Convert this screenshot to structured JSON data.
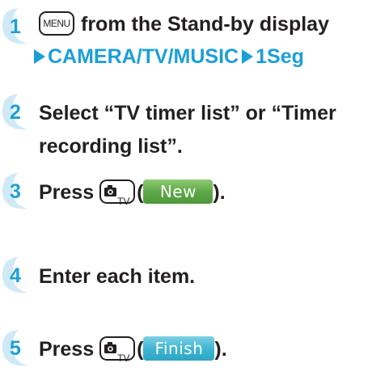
{
  "steps": [
    {
      "number": "1",
      "menu_key": "MENU",
      "line1": "from the Stand-by display",
      "path": [
        "CAMERA/TV/MUSIC",
        "1Seg"
      ]
    },
    {
      "number": "2",
      "line1": "Select “TV timer list” or “Timer",
      "line2": "recording list”."
    },
    {
      "number": "3",
      "prefix": "Press",
      "key_label": "TV",
      "open": "(",
      "softkey": "New",
      "close": ")."
    },
    {
      "number": "4",
      "text": "Enter each item."
    },
    {
      "number": "5",
      "prefix": "Press",
      "key_label": "TV",
      "open": "(",
      "softkey": "Finish",
      "close": ")."
    }
  ],
  "colors": {
    "accent": "#1a9fd8",
    "text": "#231f20",
    "softkey_new": "#5fa848",
    "softkey_finish": "#3cb5d2"
  }
}
